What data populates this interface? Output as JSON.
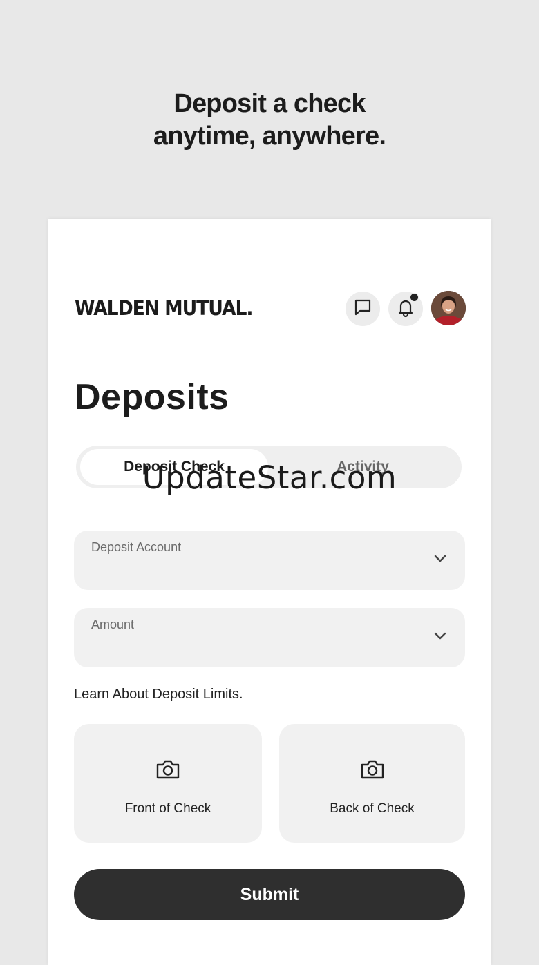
{
  "promo": {
    "line1": "Deposit a check",
    "line2": "anytime, anywhere."
  },
  "header": {
    "brand": "WALDEN MUTUAL.",
    "icons": [
      "chat-icon",
      "bell-icon"
    ],
    "has_notification": true
  },
  "page": {
    "title": "Deposits"
  },
  "tabs": [
    {
      "label": "Deposit Check",
      "selected": true
    },
    {
      "label": "Activity",
      "selected": false
    }
  ],
  "form": {
    "deposit_account_label": "Deposit Account",
    "amount_label": "Amount",
    "limits_link": "Learn About Deposit Limits.",
    "front_label": "Front of Check",
    "back_label": "Back of Check",
    "submit_label": "Submit"
  },
  "watermark": "UpdateStar.com",
  "colors": {
    "background": "#e8e8e8",
    "card": "#ffffff",
    "field": "#f1f1f1",
    "button": "#2f2f2f"
  }
}
